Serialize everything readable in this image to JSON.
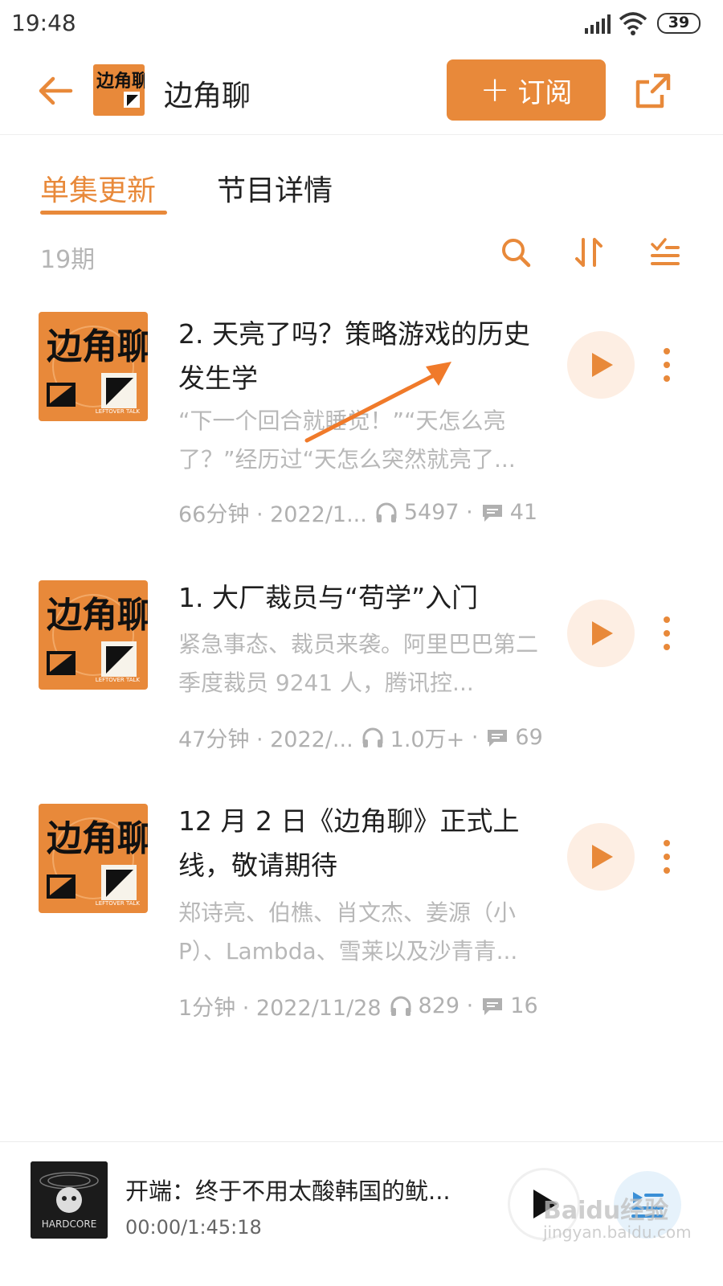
{
  "status_bar": {
    "time": "19:48",
    "battery": "39"
  },
  "header": {
    "title": "边角聊",
    "subscribe_label": "订阅"
  },
  "tabs": [
    {
      "label": "单集更新",
      "active": true
    },
    {
      "label": "节目详情",
      "active": false
    }
  ],
  "list": {
    "count_label": "19期"
  },
  "episodes": [
    {
      "title": "2. 天亮了吗？策略游戏的历史发生学",
      "description": "“下一个回合就睡觉！”“天怎么亮了？”经历过“天怎么突然就亮了...",
      "duration_date": "66分钟 · 2022/1...",
      "plays": "5497",
      "comments": "41"
    },
    {
      "title": "1. 大厂裁员与“苟学”入门",
      "description": "紧急事态、裁员来袭。阿里巴巴第二季度裁员 9241 人，腾讯控...",
      "duration_date": "47分钟 · 2022/...",
      "plays": "1.0万+",
      "comments": "69"
    },
    {
      "title": "12 月 2 日《边角聊》正式上线，敬请期待",
      "description": "郑诗亮、伯樵、肖文杰、姜源（小P）、Lambda、雪莱以及沙青青...",
      "duration_date": "1分钟 · 2022/11/28",
      "plays": "829",
      "comments": "16"
    }
  ],
  "cover_art": {
    "text": "边角聊",
    "subtext": "LEFTOVER TALK"
  },
  "mini_player": {
    "title": "开端：终于不用太酸韩国的鱿...",
    "time": "00:00/1:45:18",
    "cover_text": "HARDCORE"
  },
  "watermark": {
    "main": "Baidu经验",
    "sub": "jingyan.baidu.com"
  },
  "colors": {
    "accent": "#e8893a",
    "play_bg": "#fdeee3",
    "muted": "#b8b8b8"
  },
  "icons": [
    "back-arrow-icon",
    "share-icon",
    "search-icon",
    "sort-icon",
    "filter-list-icon",
    "play-icon",
    "more-vertical-icon",
    "headphones-icon",
    "comment-icon",
    "playlist-icon"
  ]
}
